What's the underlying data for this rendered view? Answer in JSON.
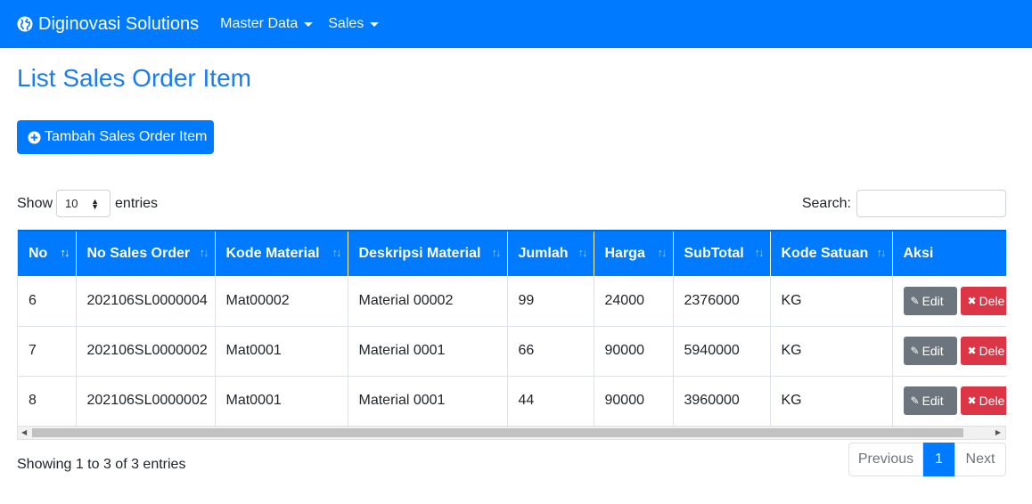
{
  "navbar": {
    "brand": "Diginovasi Solutions",
    "menu": [
      {
        "label": "Master Data"
      },
      {
        "label": "Sales"
      }
    ]
  },
  "page_title": "List Sales Order Item",
  "add_button": {
    "label": "Tambah Sales Order Item",
    "icon": "plus-circle-icon"
  },
  "length_control": {
    "show_label": "Show",
    "value": "10",
    "entries_label": "entries"
  },
  "search": {
    "label": "Search:",
    "value": ""
  },
  "table": {
    "columns": [
      "No",
      "No Sales Order",
      "Kode Material",
      "Deskripsi Material",
      "Jumlah",
      "Harga",
      "SubTotal",
      "Kode Satuan",
      "Aksi"
    ],
    "rows": [
      {
        "no": "6",
        "no_sales_order": "202106SL0000004",
        "kode_material": "Mat00002",
        "deskripsi": "Material 00002",
        "jumlah": "99",
        "harga": "24000",
        "subtotal": "2376000",
        "satuan": "KG"
      },
      {
        "no": "7",
        "no_sales_order": "202106SL0000002",
        "kode_material": "Mat0001",
        "deskripsi": "Material 0001",
        "jumlah": "66",
        "harga": "90000",
        "subtotal": "5940000",
        "satuan": "KG"
      },
      {
        "no": "8",
        "no_sales_order": "202106SL0000002",
        "kode_material": "Mat0001",
        "deskripsi": "Material 0001",
        "jumlah": "44",
        "harga": "90000",
        "subtotal": "3960000",
        "satuan": "KG"
      }
    ],
    "edit_label": "Edit",
    "delete_label": "Dele"
  },
  "info_text": "Showing 1 to 3 of 3 entries",
  "pagination": {
    "previous": "Previous",
    "current": "1",
    "next": "Next"
  },
  "colors": {
    "primary": "#007bff",
    "secondary": "#6c757d",
    "danger": "#dc3545"
  }
}
